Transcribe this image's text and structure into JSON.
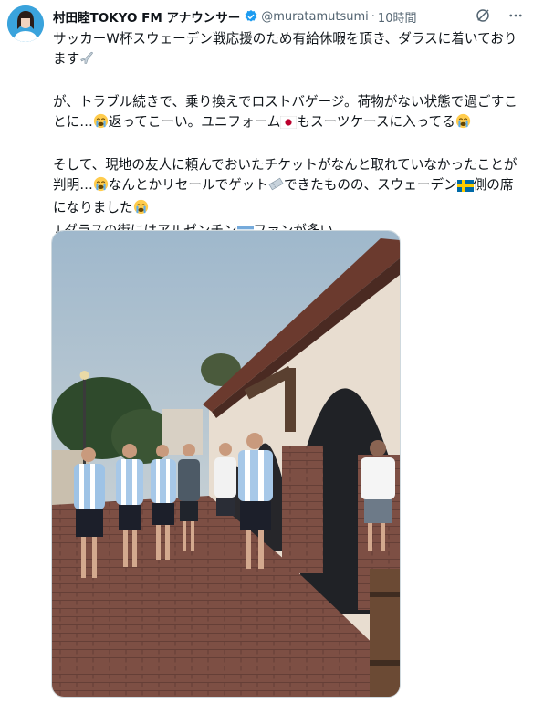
{
  "author": {
    "name": "村田睦TOKYO FM アナウンサー",
    "handle": "@muratamutsumi",
    "separator": "·",
    "time": "10時間"
  },
  "icons": {
    "verified": "verified-badge-icon",
    "grok": "grok-icon",
    "more": "more-icon",
    "airplane": "airplane-emoji",
    "cry": "loudly-crying-emoji",
    "japan_flag": "japan-flag-emoji",
    "ticket": "ticket-emoji",
    "sweden_flag": "sweden-flag-emoji",
    "argentina_flag": "argentina-flag-emoji"
  },
  "tweet": {
    "p1": "サッカーW杯スウェーデン戦応援のため有給休暇を頂き、ダラスに着いております",
    "p2a": "が、トラブル続きで、乗り換えでロストバゲージ。荷物がない状態で過ごすことに…",
    "p2b": "返ってこーい。ユニフォーム",
    "p2c": "もスーツケースに入ってる",
    "p3a": "そして、現地の友人に頼んでおいたチケットがなんと取れていなかったことが判明…",
    "p3b": "なんとかリセールでゲット",
    "p3c": "できたものの、スウェーデン",
    "p3d": "側の席になりました",
    "p4a": "↓ダラスの街にはアルゼンチン",
    "p4b": "ファンが多い"
  },
  "colors": {
    "text": "#0f1419",
    "secondary": "#536471",
    "verified": "#1d9bf0",
    "argentina_blue": "#75aadb"
  }
}
